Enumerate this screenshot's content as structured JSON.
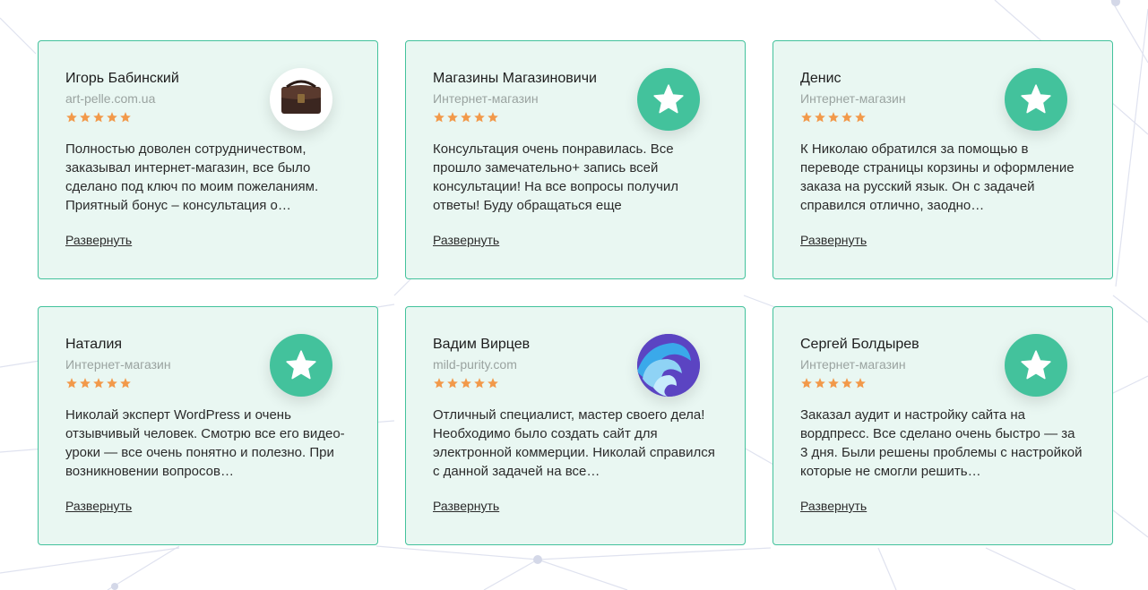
{
  "reviews": [
    {
      "name": "Игорь Бабинский",
      "source": "art-pelle.com.ua",
      "rating": 5,
      "avatar": "bag-photo",
      "text": "Полностью доволен сотрудничеством, заказывал интернет-магазин, все было сделано под ключ по моим пожеланиям. Приятный бонус – консультация о…",
      "expand_label": "Развернуть"
    },
    {
      "name": "Магазины Магазиновичи",
      "source": "Интернет-магазин",
      "rating": 5,
      "avatar": "star-icon",
      "text": "Консультация очень понравилась. Все прошло замечательно+ запись всей консультации! На все вопросы получил ответы! Буду обращаться еще",
      "expand_label": "Развернуть"
    },
    {
      "name": "Денис",
      "source": "Интернет-магазин",
      "rating": 5,
      "avatar": "star-icon",
      "text": "К Николаю обратился за помощью в переводе страницы корзины и оформление заказа на русский язык. Он с задачей справился отлично, заодно…",
      "expand_label": "Развернуть"
    },
    {
      "name": "Наталия",
      "source": "Интернет-магазин",
      "rating": 5,
      "avatar": "star-icon",
      "text": "Николай эксперт WordPress и очень отзывчивый человек. Смотрю все его видео-уроки — все очень понятно и полезно. При возникновении вопросов…",
      "expand_label": "Развернуть"
    },
    {
      "name": "Вадим Вирцев",
      "source": "mild-purity.com",
      "rating": 5,
      "avatar": "wave-logo",
      "text": "Отличный специалист, мастер своего дела! Необходимо было создать сайт для электронной коммерции. Николай справился с данной задачей на все…",
      "expand_label": "Развернуть"
    },
    {
      "name": "Сергей Болдырев",
      "source": "Интернет-магазин",
      "rating": 5,
      "avatar": "star-icon",
      "text": "Заказал аудит и настройку сайта на вордпресс. Все сделано очень быстро — за 3 дня. Были решены проблемы с настройкой которые не смогли решить…",
      "expand_label": "Развернуть"
    }
  ],
  "colors": {
    "accent": "#43c29c",
    "card_bg": "#e9f7f2",
    "star": "#f2994a",
    "text": "#2b2b2b",
    "muted": "#9aa3a0"
  }
}
